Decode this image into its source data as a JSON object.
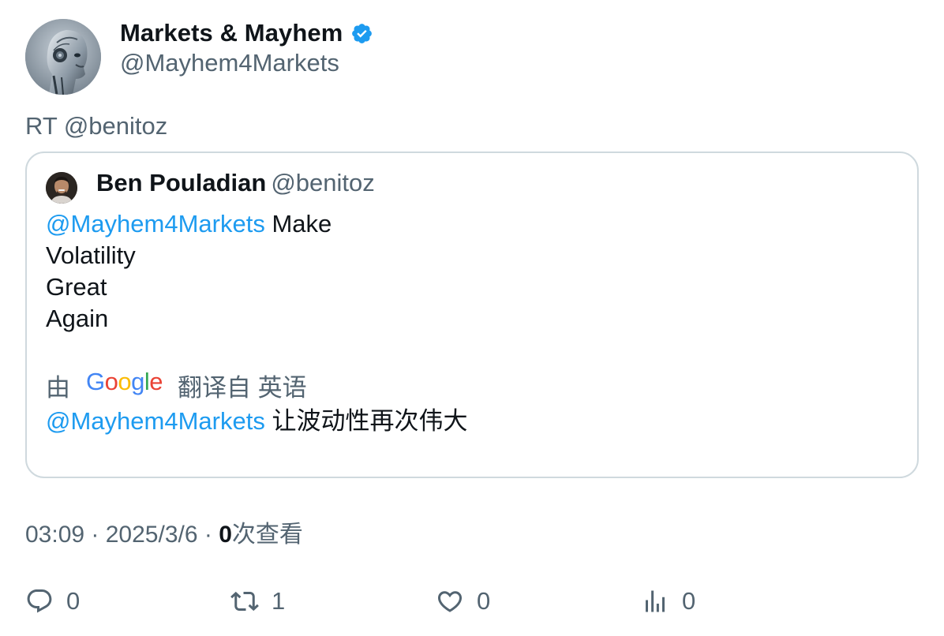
{
  "author": {
    "display_name": "Markets & Mayhem",
    "handle": "@Mayhem4Markets",
    "verified": true,
    "avatar_icon": "robot-avatar"
  },
  "retweet_text": "RT @benitoz",
  "quoted": {
    "author_name": "Ben Pouladian",
    "author_handle": "@benitoz",
    "avatar_icon": "person-avatar",
    "mention": "@Mayhem4Markets",
    "lines": [
      "Make",
      "Volatility",
      "Great",
      "Again"
    ],
    "translate_prefix": "由",
    "translate_brand": "Google",
    "translate_suffix": "翻译自 英语",
    "translated_mention": "@Mayhem4Markets",
    "translated_text": "让波动性再次伟大"
  },
  "meta": {
    "time": "03:09",
    "separator": " · ",
    "date": "2025/3/6",
    "views_count": "0",
    "views_label": "次查看"
  },
  "actions": {
    "reply_count": "0",
    "retweet_count": "1",
    "like_count": "0",
    "views_count": "0"
  },
  "colors": {
    "accent": "#1d9bf0",
    "secondary_text": "#536471",
    "border": "#cfd9de"
  }
}
